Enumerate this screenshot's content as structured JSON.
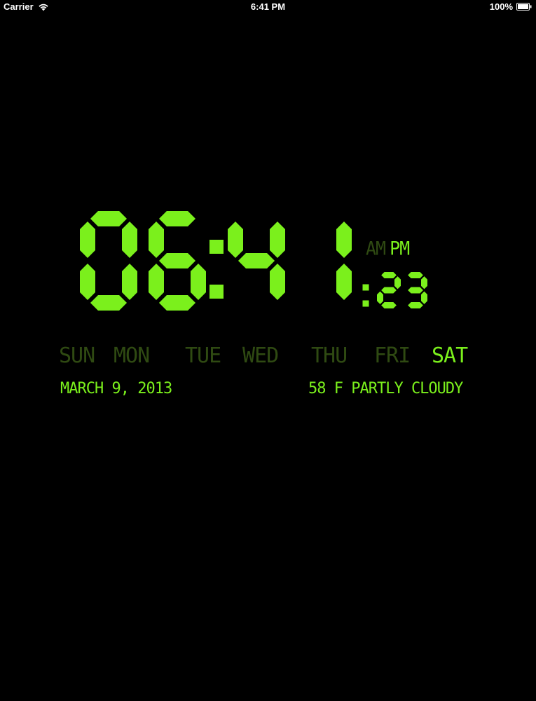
{
  "status_bar": {
    "carrier": "Carrier",
    "time": "6:41 PM",
    "battery": "100%",
    "icons": [
      "wifi-icon",
      "battery-icon"
    ]
  },
  "clock": {
    "time": "06:41",
    "seconds": "23",
    "am_label": "AM",
    "pm_label": "PM",
    "active_period": "PM"
  },
  "weekdays": {
    "items": [
      "SUN",
      "MON",
      "TUE",
      "WED",
      "THU",
      "FRI",
      "SAT"
    ],
    "active": "SAT"
  },
  "info": {
    "date": "MARCH 9, 2013",
    "weather": "58 F PARTLY CLOUDY"
  },
  "colors": {
    "active": "#7bf01c",
    "inactive": "#2f4a12",
    "background": "#000000",
    "status_text": "#ffffff"
  }
}
